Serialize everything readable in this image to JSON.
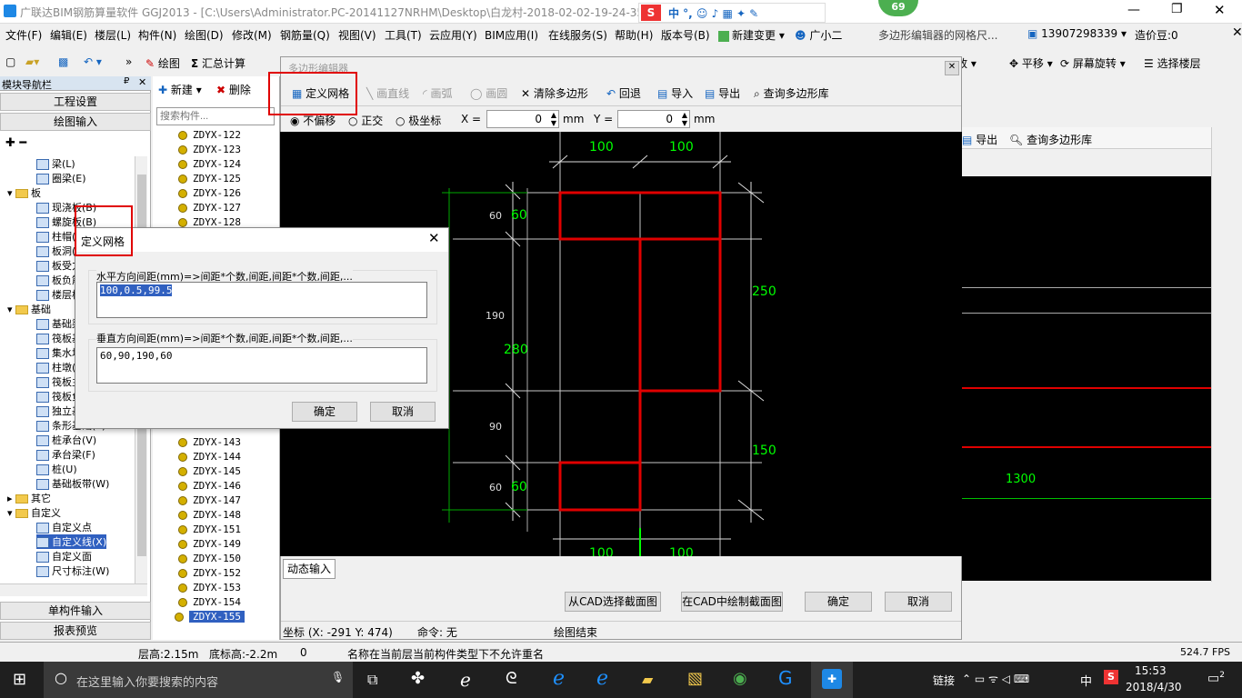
{
  "titlebar": {
    "title": "广联达BIM钢筋算量软件 GGJ2013 - [C:\\Users\\Administrator.PC-20141127NRHM\\Desktop\\白龙村-2018-02-02-19-24-35",
    "badge": "69"
  },
  "menu": [
    "文件(F)",
    "编辑(E)",
    "楼层(L)",
    "构件(N)",
    "绘图(D)",
    "修改(M)",
    "钢筋量(Q)",
    "视图(V)",
    "工具(T)",
    "云应用(Y)",
    "BIM应用(I)",
    "在线服务(S)",
    "帮助(H)",
    "版本号(B)",
    "新建变更",
    "广小二"
  ],
  "menu_right": {
    "notice": "多边形编辑器的网格尺...",
    "phone": "13907298339",
    "price": "造价豆:0"
  },
  "toolbar": {
    "draw": "绘图",
    "sum": "汇总计算",
    "zoom": "缩放",
    "pan": "平移",
    "rotate": "屏幕旋转",
    "select_floor": "选择楼层"
  },
  "leftnav": {
    "title": "模块导航栏",
    "project_settings": "工程设置",
    "draw_input": "绘图输入",
    "single_input": "单构件输入",
    "report": "报表预览",
    "items": [
      {
        "label": "梁(L)",
        "indent": 2
      },
      {
        "label": "圈梁(E)",
        "indent": 2
      },
      {
        "label": "板",
        "indent": 1,
        "folder": true
      },
      {
        "label": "现浇板(B)",
        "indent": 2
      },
      {
        "label": "螺旋板(B)",
        "indent": 2
      },
      {
        "label": "柱帽(V)",
        "indent": 2
      },
      {
        "label": "板洞(N)",
        "indent": 2
      },
      {
        "label": "板受力筋(S)",
        "indent": 2
      },
      {
        "label": "板负筋(F)",
        "indent": 2
      },
      {
        "label": "楼层板带(H)",
        "indent": 2
      },
      {
        "label": "基础",
        "indent": 1,
        "folder": true
      },
      {
        "label": "基础梁(F)",
        "indent": 2
      },
      {
        "label": "筏板基础(M)",
        "indent": 2
      },
      {
        "label": "集水坑(K)",
        "indent": 2
      },
      {
        "label": "柱墩(Y)",
        "indent": 2
      },
      {
        "label": "筏板主筋(R)",
        "indent": 2
      },
      {
        "label": "筏板负筋(X)",
        "indent": 2
      },
      {
        "label": "独立基础(P)",
        "indent": 2
      },
      {
        "label": "条形基础(T)",
        "indent": 2
      },
      {
        "label": "桩承台(V)",
        "indent": 2
      },
      {
        "label": "承台梁(F)",
        "indent": 2
      },
      {
        "label": "桩(U)",
        "indent": 2
      },
      {
        "label": "基础板带(W)",
        "indent": 2
      },
      {
        "label": "其它",
        "indent": 1,
        "folder": true
      },
      {
        "label": "自定义",
        "indent": 1,
        "folder": true
      },
      {
        "label": "自定义点",
        "indent": 2
      },
      {
        "label": "自定义线(X)",
        "indent": 2
      },
      {
        "label": "自定义面",
        "indent": 2
      },
      {
        "label": "尺寸标注(W)",
        "indent": 2
      }
    ]
  },
  "complist": {
    "new": "新建",
    "delete": "删除",
    "search_placeholder": "搜索构件...",
    "items": [
      "ZDYX-122",
      "ZDYX-123",
      "ZDYX-124",
      "ZDYX-125",
      "ZDYX-126",
      "ZDYX-127",
      "ZDYX-128",
      "ZDYX-143",
      "ZDYX-144",
      "ZDYX-145",
      "ZDYX-146",
      "ZDYX-147",
      "ZDYX-148",
      "ZDYX-151",
      "ZDYX-149",
      "ZDYX-150",
      "ZDYX-152",
      "ZDYX-153",
      "ZDYX-154",
      "ZDYX-155"
    ]
  },
  "editor": {
    "title": "多边形编辑器",
    "tools": [
      "定义网格",
      "画直线",
      "画弧",
      "画圆",
      "清除多边形",
      "回退",
      "导入",
      "导出",
      "查询多边形库"
    ],
    "modes": [
      "不偏移",
      "正交",
      "极坐标"
    ],
    "x_label": "X =",
    "x_value": "0",
    "y_label": "Y =",
    "y_value": "0",
    "unit": "mm",
    "dynamic_input": "动态输入",
    "buttons": [
      "从CAD选择截面图",
      "在CAD中绘制截面图",
      "确定",
      "取消"
    ],
    "coords": "坐标 (X: -291 Y: 474)",
    "command": "命令: 无",
    "status": "绘图结束"
  },
  "cad": {
    "top_dims": [
      "100",
      "100"
    ],
    "bottom_dims": [
      "100",
      "100"
    ],
    "left_green": [
      "60",
      "280",
      "60"
    ],
    "left_white": [
      "60",
      "190",
      "90",
      "60"
    ],
    "right_green": [
      "250",
      "150"
    ],
    "right_value": "1300"
  },
  "right_panel": {
    "export": "导出",
    "query": "查询多边形库"
  },
  "dialog": {
    "title": "定义网格",
    "h_label": "水平方向间距(mm)=>间距*个数,间距,间距*个数,间距,...",
    "h_value": "100,0.5,99.5",
    "v_label": "垂直方向间距(mm)=>间距*个数,间距,间距*个数,间距,...",
    "v_value": "60,90,190,60",
    "ok": "确定",
    "cancel": "取消"
  },
  "status": {
    "floor_height": "层高:2.15m",
    "base_height": "底标高:-2.2m",
    "zero": "0",
    "message": "名称在当前层当前构件类型下不允许重名",
    "fps": "524.7 FPS"
  },
  "taskbar": {
    "search": "在这里输入你要搜索的内容",
    "link": "链接",
    "lang": "中",
    "time": "15:53",
    "date": "2018/4/30",
    "notif": "2"
  },
  "colors": {
    "red_mark": "#e00000",
    "cad_green": "#00ff00",
    "selected": "#3060c0"
  }
}
